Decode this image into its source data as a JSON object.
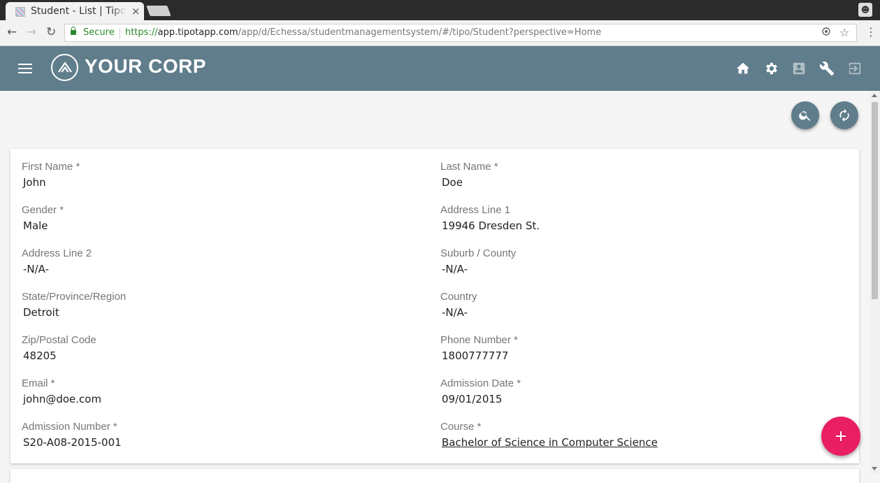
{
  "browser": {
    "tab_title": "Student - List | Tipo",
    "tab_close": "×",
    "secure_label": "Secure",
    "url_scheme": "https://",
    "url_host": "app.tipotapp.com",
    "url_path": "/app/d/Echessa/studentmanagementsystem/#/tipo/Student?perspective=Home",
    "back_glyph": "←",
    "forward_glyph": "→",
    "reload_glyph": "↻",
    "star_glyph": "☆",
    "menu_glyph": "⋮"
  },
  "header": {
    "brand": "YOUR CORP",
    "icons": [
      "home-icon",
      "settings-icon",
      "account-box-icon",
      "wrench-icon",
      "exit-icon"
    ],
    "bar_color": "#607d8b"
  },
  "actions": {
    "search_icon": "search-icon",
    "refresh_icon": "refresh-icon",
    "add_icon": "plus-icon",
    "add_color": "#e91e63"
  },
  "record": {
    "fields": [
      {
        "label": "First Name *",
        "value": "John"
      },
      {
        "label": "Last Name *",
        "value": "Doe"
      },
      {
        "label": "Gender *",
        "value": "Male"
      },
      {
        "label": "Address Line 1",
        "value": "19946 Dresden St."
      },
      {
        "label": "Address Line 2",
        "value": "-N/A-"
      },
      {
        "label": "Suburb / County",
        "value": "-N/A-"
      },
      {
        "label": "State/Province/Region",
        "value": "Detroit"
      },
      {
        "label": "Country",
        "value": "-N/A-"
      },
      {
        "label": "Zip/Postal Code",
        "value": "48205"
      },
      {
        "label": "Phone Number *",
        "value": "1800777777"
      },
      {
        "label": "Email *",
        "value": "john@doe.com"
      },
      {
        "label": "Admission Date *",
        "value": "09/01/2015"
      },
      {
        "label": "Admission Number *",
        "value": "S20-A08-2015-001"
      },
      {
        "label": "Course *",
        "value": "Bachelor of Science in Computer Science"
      }
    ]
  }
}
